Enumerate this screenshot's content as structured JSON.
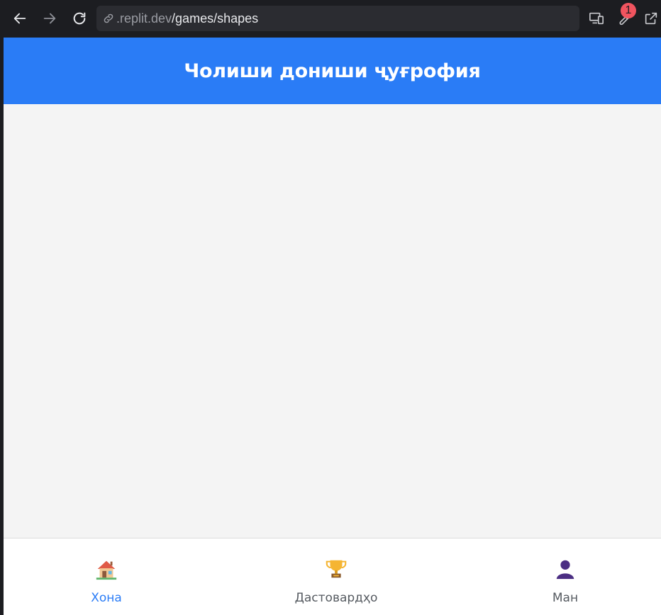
{
  "browser": {
    "url_host": ".replit.dev",
    "url_path": "/games/shapes",
    "badge_count": "1"
  },
  "app": {
    "title": "Чолиши дониши ҷуғрофия",
    "accent_color": "#2a7cf6"
  },
  "tabs": [
    {
      "label": "Хона",
      "icon": "house-icon",
      "active": true
    },
    {
      "label": "Дастовардҳо",
      "icon": "trophy-icon",
      "active": false
    },
    {
      "label": "Ман",
      "icon": "person-icon",
      "active": false
    }
  ]
}
